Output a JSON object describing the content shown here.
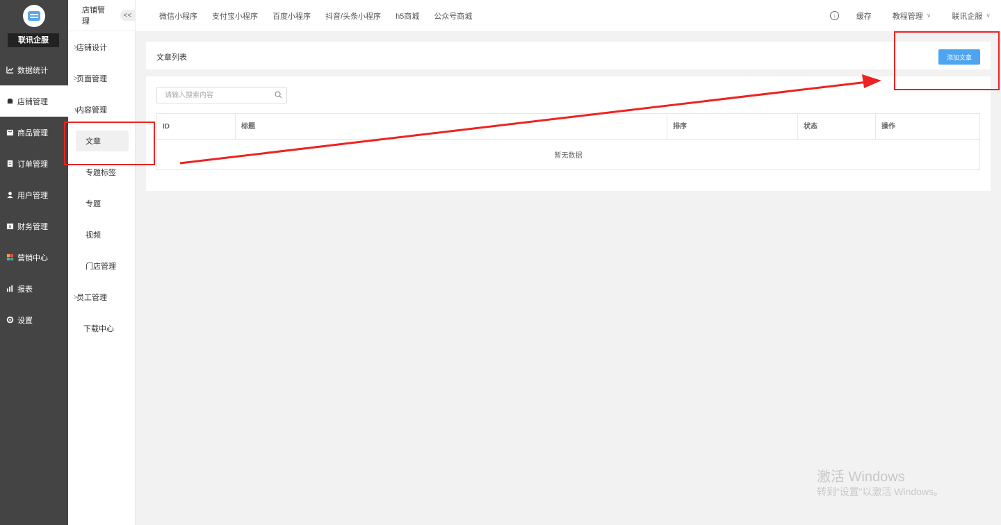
{
  "brand": {
    "name": "联讯企服"
  },
  "sidebar": {
    "items": [
      {
        "label": "数据统计",
        "icon": "chart-icon"
      },
      {
        "label": "店铺管理",
        "icon": "store-icon",
        "active": true
      },
      {
        "label": "商品管理",
        "icon": "goods-icon"
      },
      {
        "label": "订单管理",
        "icon": "order-icon"
      },
      {
        "label": "用户管理",
        "icon": "user-icon"
      },
      {
        "label": "财务管理",
        "icon": "finance-icon"
      },
      {
        "label": "营销中心",
        "icon": "marketing-icon"
      },
      {
        "label": "报表",
        "icon": "report-icon"
      },
      {
        "label": "设置",
        "icon": "settings-icon"
      }
    ]
  },
  "subsidebar": {
    "title": "店铺管理",
    "collapse_label": "<<",
    "items": [
      {
        "label": "店铺设计",
        "chevron": ">"
      },
      {
        "label": "页面管理",
        "chevron": ">"
      },
      {
        "label": "内容管理",
        "chevron": "∨"
      },
      {
        "label": "文章"
      },
      {
        "label": "专题标签"
      },
      {
        "label": "专题"
      },
      {
        "label": "视频"
      },
      {
        "label": "门店管理"
      },
      {
        "label": "员工管理",
        "chevron": ">"
      },
      {
        "label": "下载中心"
      }
    ]
  },
  "topbar": {
    "tabs": [
      "微信小程序",
      "支付宝小程序",
      "百度小程序",
      "抖音/头条小程序",
      "h5商城",
      "公众号商城"
    ],
    "cache_label": "缓存",
    "tutorial_label": "教程管理",
    "account_label": "联讯企服"
  },
  "main": {
    "title": "文章列表",
    "add_button": "添加文章",
    "search_placeholder": "请输入搜索内容",
    "table": {
      "columns": [
        "ID",
        "标题",
        "排序",
        "状态",
        "操作"
      ],
      "empty_text": "暂无数据"
    }
  },
  "watermark": {
    "line1": "激活 Windows",
    "line2": "转到“设置”以激活 Windows。"
  },
  "colors": {
    "sidebar_bg": "#444444",
    "primary": "#4da4f0",
    "annotation": "#ee2222"
  }
}
